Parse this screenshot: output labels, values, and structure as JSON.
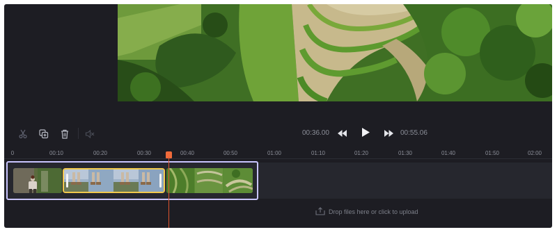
{
  "toolbar": {
    "split_icon": "scissors-icon",
    "duplicate_icon": "duplicate-icon",
    "delete_icon": "trash-icon",
    "mute_icon": "volume-mute-icon"
  },
  "player": {
    "current_time": "00:36.00",
    "total_time": "00:55.06",
    "rewind_icon": "rewind-icon",
    "play_icon": "play-icon",
    "forward_icon": "fast-forward-icon"
  },
  "timeline": {
    "ticks": [
      "0",
      "00:10",
      "00:20",
      "00:30",
      "00:40",
      "00:50",
      "01:00",
      "01:10",
      "01:20",
      "01:30",
      "01:40",
      "01:50",
      "02:00"
    ]
  },
  "upload": {
    "label": "Drop files here or click to upload",
    "icon": "upload-icon"
  },
  "colors": {
    "background": "#1d1d23",
    "playhead": "#f06a3a",
    "selected_clip": "#f2c94c",
    "highlight": "#c9c5ff"
  }
}
